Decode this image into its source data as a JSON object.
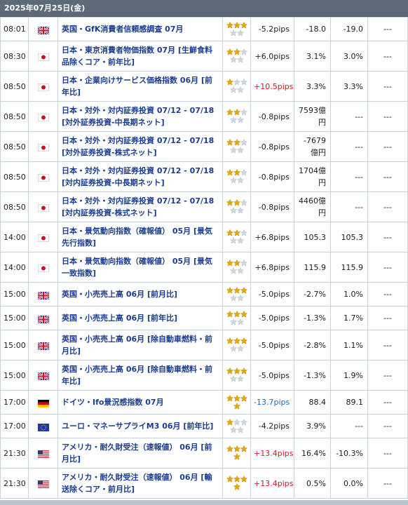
{
  "date_header": "2025年07月25日(金)",
  "colors": {
    "header_bg": "#5d6b79",
    "link_blue": "#1a3d8f",
    "positive_red": "#e0141e",
    "negative_blue": "#1a6bcc",
    "star_gold": "#e6a700",
    "star_empty": "#cfd6dd",
    "border": "#c9d3dc"
  },
  "rows": [
    {
      "time": "08:01",
      "country": "uk",
      "flag_icon": "uk-flag-icon",
      "name": "英国・GfK消費者信頼感調査 07月",
      "importance": 3,
      "pips": "-5.2pips",
      "pips_dir": "neutral",
      "actual": "-18.0",
      "forecast": "-19.0",
      "previous": "---"
    },
    {
      "time": "08:30",
      "country": "jp",
      "flag_icon": "japan-flag-icon",
      "name": "日本・東京消費者物価指数 07月 [生鮮食料品除くコア・前年比]",
      "importance": 2,
      "pips": "+6.0pips",
      "pips_dir": "neutral",
      "actual": "3.1%",
      "forecast": "3.0%",
      "previous": "---"
    },
    {
      "time": "08:50",
      "country": "jp",
      "flag_icon": "japan-flag-icon",
      "name": "日本・企業向けサービス価格指数 06月 [前年比]",
      "importance": 1,
      "pips": "+10.5pips",
      "pips_dir": "up",
      "actual": "3.3%",
      "forecast": "3.3%",
      "previous": "---"
    },
    {
      "time": "08:50",
      "country": "jp",
      "flag_icon": "japan-flag-icon",
      "name": "日本・対外・対内証券投資 07/12 - 07/18 [対外証券投資-中長期ネット]",
      "importance": 2,
      "pips": "-0.8pips",
      "pips_dir": "neutral",
      "actual": "7593億円",
      "forecast": "---",
      "previous": "---"
    },
    {
      "time": "08:50",
      "country": "jp",
      "flag_icon": "japan-flag-icon",
      "name": "日本・対外・対内証券投資 07/12 - 07/18 [対外証券投資-株式ネット]",
      "importance": 2,
      "pips": "-0.8pips",
      "pips_dir": "neutral",
      "actual": "-7679億円",
      "forecast": "---",
      "previous": "---"
    },
    {
      "time": "08:50",
      "country": "jp",
      "flag_icon": "japan-flag-icon",
      "name": "日本・対外・対内証券投資 07/12 - 07/18 [対内証券投資-中長期ネット]",
      "importance": 2,
      "pips": "-0.8pips",
      "pips_dir": "neutral",
      "actual": "1704億円",
      "forecast": "---",
      "previous": "---"
    },
    {
      "time": "08:50",
      "country": "jp",
      "flag_icon": "japan-flag-icon",
      "name": "日本・対外・対内証券投資 07/12 - 07/18 [対内証券投資-株式ネット]",
      "importance": 2,
      "pips": "-0.8pips",
      "pips_dir": "neutral",
      "actual": "4460億円",
      "forecast": "---",
      "previous": "---"
    },
    {
      "time": "14:00",
      "country": "jp",
      "flag_icon": "japan-flag-icon",
      "name": "日本・景気動向指数（確報値） 05月 [景気先行指数]",
      "importance": 2,
      "pips": "+6.8pips",
      "pips_dir": "neutral",
      "actual": "105.3",
      "forecast": "105.3",
      "previous": "---"
    },
    {
      "time": "14:00",
      "country": "jp",
      "flag_icon": "japan-flag-icon",
      "name": "日本・景気動向指数（確報値） 05月 [景気一致指数]",
      "importance": 2,
      "pips": "+6.8pips",
      "pips_dir": "neutral",
      "actual": "115.9",
      "forecast": "115.9",
      "previous": "---"
    },
    {
      "time": "15:00",
      "country": "uk",
      "flag_icon": "uk-flag-icon",
      "name": "英国・小売売上高 06月 [前月比]",
      "importance": 3,
      "pips": "-5.0pips",
      "pips_dir": "neutral",
      "actual": "-2.7%",
      "forecast": "1.0%",
      "previous": "---"
    },
    {
      "time": "15:00",
      "country": "uk",
      "flag_icon": "uk-flag-icon",
      "name": "英国・小売売上高 06月 [前年比]",
      "importance": 3,
      "pips": "-5.0pips",
      "pips_dir": "neutral",
      "actual": "-1.3%",
      "forecast": "1.7%",
      "previous": "---"
    },
    {
      "time": "15:00",
      "country": "uk",
      "flag_icon": "uk-flag-icon",
      "name": "英国・小売売上高 06月 [除自動車燃料・前月比]",
      "importance": 3,
      "pips": "-5.0pips",
      "pips_dir": "neutral",
      "actual": "-2.8%",
      "forecast": "1.1%",
      "previous": "---"
    },
    {
      "time": "15:00",
      "country": "uk",
      "flag_icon": "uk-flag-icon",
      "name": "英国・小売売上高 06月 [除自動車燃料・前年比]",
      "importance": 3,
      "pips": "-5.0pips",
      "pips_dir": "neutral",
      "actual": "-1.3%",
      "forecast": "1.9%",
      "previous": "---"
    },
    {
      "time": "17:00",
      "country": "de",
      "flag_icon": "germany-flag-icon",
      "name": "ドイツ・Ifo景況感指数 07月",
      "importance": 4,
      "pips": "-13.7pips",
      "pips_dir": "down",
      "actual": "88.4",
      "forecast": "89.1",
      "previous": "---"
    },
    {
      "time": "17:00",
      "country": "eu",
      "flag_icon": "eu-flag-icon",
      "name": "ユーロ・マネーサプライM3 06月 [前年比]",
      "importance": 1,
      "pips": "-4.2pips",
      "pips_dir": "neutral",
      "actual": "3.9%",
      "forecast": "---",
      "previous": "---"
    },
    {
      "time": "21:30",
      "country": "us",
      "flag_icon": "us-flag-icon",
      "name": "アメリカ・耐久財受注（速報値） 06月 [前月比]",
      "importance": 4,
      "pips": "+13.4pips",
      "pips_dir": "up",
      "actual": "16.4%",
      "forecast": "-10.3%",
      "previous": "---"
    },
    {
      "time": "21:30",
      "country": "us",
      "flag_icon": "us-flag-icon",
      "name": "アメリカ・耐久財受注（速報値） 06月 [輸送除くコア・前月比]",
      "importance": 4,
      "pips": "+13.4pips",
      "pips_dir": "up",
      "actual": "0.5%",
      "forecast": "0.0%",
      "previous": "---"
    }
  ]
}
